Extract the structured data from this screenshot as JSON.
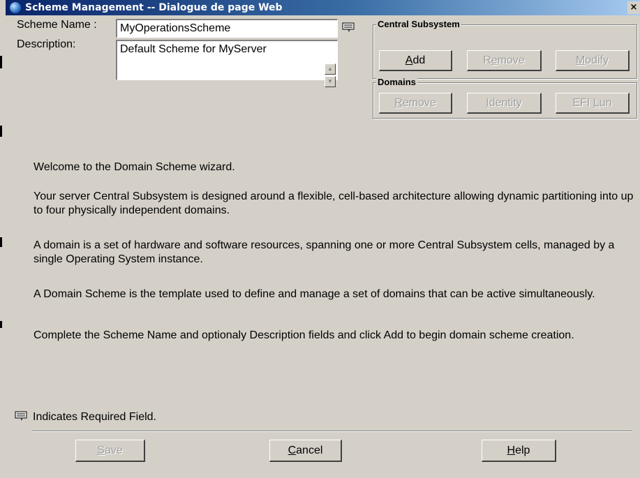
{
  "window": {
    "title": "Scheme Management -- Dialogue de page Web",
    "close_glyph": "×"
  },
  "form": {
    "scheme_name_label": "Scheme Name :",
    "scheme_name_value": "MyOperationsScheme",
    "description_label": "Description:",
    "description_value": "Default Scheme for MyServer"
  },
  "central_subsystem": {
    "legend": "Central Subsystem",
    "add": {
      "pre": "",
      "key": "A",
      "post": "dd"
    },
    "remove": {
      "pre": "R",
      "key": "e",
      "post": "move"
    },
    "modify": {
      "pre": "",
      "key": "M",
      "post": "odify"
    }
  },
  "domains": {
    "legend": "Domains",
    "remove": {
      "pre": "",
      "key": "R",
      "post": "emove"
    },
    "identity": {
      "pre": "",
      "key": "I",
      "post": "dentity"
    },
    "efi_lun": {
      "pre": "EFI ",
      "key": "L",
      "post": "un"
    }
  },
  "intro": {
    "p1": "Welcome to the Domain Scheme wizard.",
    "p2": "Your server Central Subsystem is designed around a flexible, cell-based architecture allowing dynamic partitioning into up to four physically independent domains.",
    "p3": "A domain is a set of hardware and software resources, spanning one or more Central Subsystem cells, managed by a single Operating System instance.",
    "p4": "A Domain Scheme is the template used to define and manage a set of domains that can be active simultaneously.",
    "p5": "Complete the Scheme Name and optionaly Description fields and click Add to begin domain scheme creation."
  },
  "required_note": "Indicates Required Field.",
  "footer": {
    "save": {
      "pre": "",
      "key": "S",
      "post": "ave"
    },
    "cancel": {
      "pre": "",
      "key": "C",
      "post": "ancel"
    },
    "help": {
      "pre": "",
      "key": "H",
      "post": "elp"
    }
  },
  "colors": {
    "window_bg": "#d4d0c8",
    "titlebar_start": "#0a246a",
    "titlebar_end": "#a6caf0",
    "disabled_text": "#a0a0a0"
  }
}
